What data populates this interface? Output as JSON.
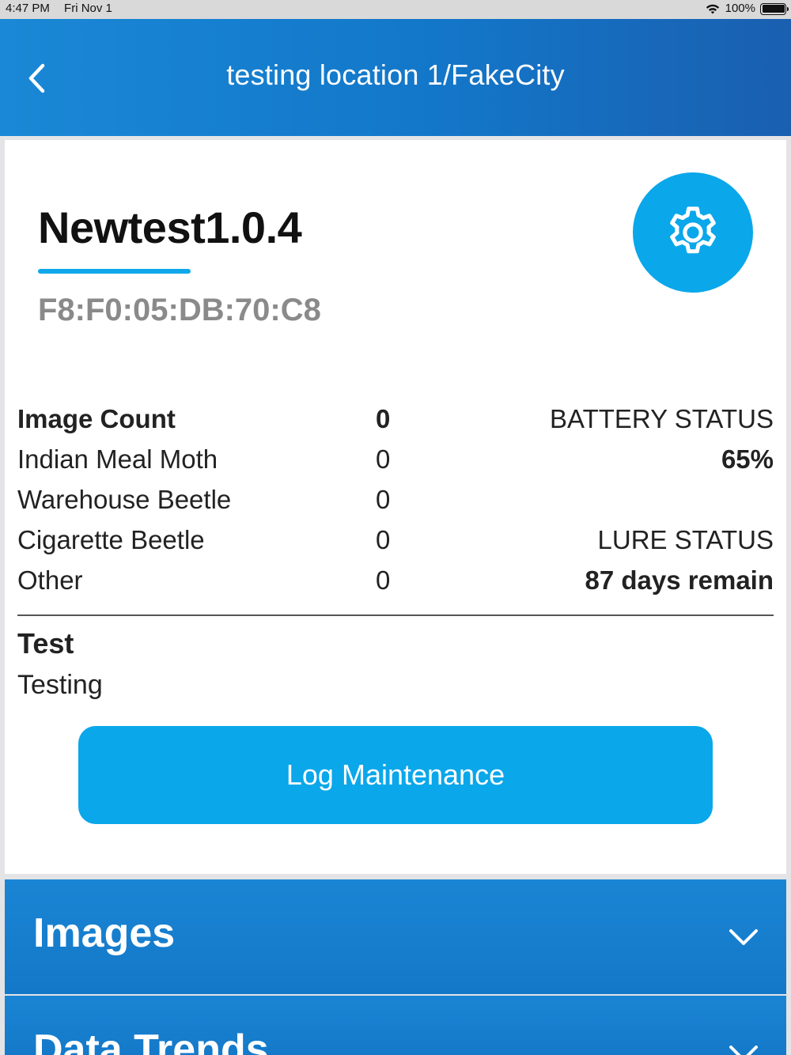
{
  "status_bar": {
    "time": "4:47 PM",
    "date": "Fri Nov 1",
    "battery_text": "100%",
    "battery_level": 1.0,
    "icons": [
      "wifi-icon",
      "battery-icon"
    ]
  },
  "header": {
    "title": "testing location 1/FakeCity",
    "back_icon": "chevron-left-icon"
  },
  "device": {
    "name": "Newtest1.0.4",
    "mac_address": "F8:F0:05:DB:70:C8",
    "settings_icon": "gear-icon"
  },
  "counts": [
    {
      "label": "Image Count",
      "value": "0"
    },
    {
      "label": "Indian Meal Moth",
      "value": "0"
    },
    {
      "label": "Warehouse Beetle",
      "value": "0"
    },
    {
      "label": "Cigarette Beetle",
      "value": "0"
    },
    {
      "label": "Other",
      "value": "0"
    }
  ],
  "battery_status": {
    "label": "BATTERY STATUS",
    "value": "65%"
  },
  "lure_status": {
    "label": "LURE STATUS",
    "value": "87 days remain"
  },
  "note": {
    "title": "Test",
    "text": "Testing"
  },
  "log_button": {
    "label": "Log Maintenance"
  },
  "sections": [
    {
      "label": "Images",
      "icon": "chevron-down-icon"
    },
    {
      "label": "Data Trends",
      "icon": "chevron-down-icon"
    }
  ],
  "colors": {
    "header_blue": "#1377c9",
    "accent_cyan": "#0aa7ea",
    "mac_gray": "#8a8a8a"
  }
}
